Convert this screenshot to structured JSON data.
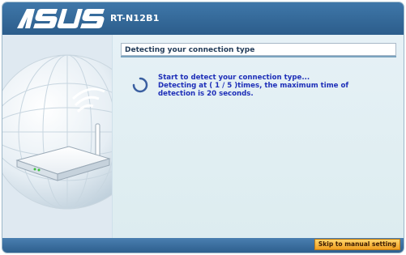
{
  "header": {
    "logo_text": "ASUS",
    "model": "RT-N12B1"
  },
  "section": {
    "title": "Detecting your connection type"
  },
  "detection": {
    "line1": "Start to detect your connection type...",
    "line2": "Detecting at ( 1 / 5 )times, the maximum time of",
    "line3": "detection is 20 seconds."
  },
  "footer": {
    "manual_button_label": "Skip to manual setting"
  },
  "colors": {
    "header_blue": "#2c5d8b",
    "text_blue": "#1e2fb8",
    "button_orange": "#f0a020"
  },
  "icons": {
    "spinner": "loading-spinner-icon",
    "router": "router-illustration-icon"
  }
}
